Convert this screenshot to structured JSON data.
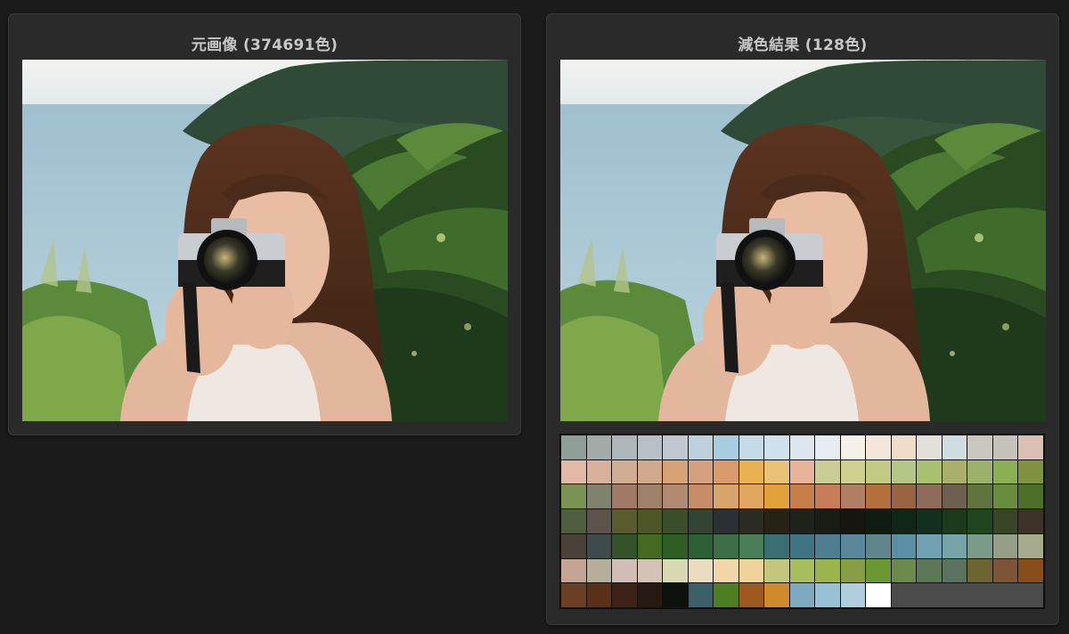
{
  "left_panel": {
    "title": "元画像 (374691色)"
  },
  "right_panel": {
    "title": "減色結果 (128色)"
  },
  "photo": {
    "sky_color": "#e9eef0",
    "sea_color": "#a9c6d2",
    "hill_color": "#2f4a36",
    "foliage_color": "#3d6b2a",
    "hair_color": "#4a2a18",
    "skin_color": "#e8bda3",
    "shirt_color": "#efe8e2",
    "camera_body": "#c9ccd0",
    "camera_lens": "#1a1a1a"
  },
  "palette": {
    "columns": 19,
    "colors": [
      "#8f9f98",
      "#a3aaa8",
      "#adb6b9",
      "#b6c1c6",
      "#bfc8cf",
      "#bdd0dc",
      "#a9cde0",
      "#c5dbe8",
      "#cfe1ec",
      "#dbe6ef",
      "#e6ecf1",
      "#f5f1e6",
      "#f3e7dc",
      "#efdccb",
      "#e3e0dc",
      "#cfdde3",
      "#cac7c0",
      "#c6c2bb",
      "#dbbfb5",
      "#e2b9a6",
      "#d9b09b",
      "#cfac92",
      "#d1a98e",
      "#d6a276",
      "#d5a07f",
      "#d99a6c",
      "#e9b14f",
      "#eac178",
      "#e7b39a",
      "#cbcd96",
      "#cdd08e",
      "#c3ca84",
      "#b4c686",
      "#a9bf72",
      "#aab06b",
      "#9cb26a",
      "#8caf53",
      "#7e923f",
      "#7a9252",
      "#80816e",
      "#9e7a66",
      "#9f8068",
      "#b08a74",
      "#c68e68",
      "#d7a46b",
      "#e0a660",
      "#e1a23c",
      "#c97e4a",
      "#c77e58",
      "#b07e64",
      "#b3703b",
      "#9a6442",
      "#8d6a5a",
      "#6d6052",
      "#60743f",
      "#6a8c3e",
      "#4c702a",
      "#4f5e3e",
      "#5c544b",
      "#5a5b2f",
      "#4e5527",
      "#3a4e2c",
      "#344433",
      "#2b3034",
      "#2c2b22",
      "#262214",
      "#1f221a",
      "#1a1d14",
      "#17150f",
      "#0f1c12",
      "#102616",
      "#13301e",
      "#1e3a1c",
      "#21461f",
      "#3a4426",
      "#3c3428",
      "#4a4238",
      "#3f4a4a",
      "#36522a",
      "#456b22",
      "#305c26",
      "#2e5e36",
      "#3c6e48",
      "#487d58",
      "#3b6e72",
      "#3e7484",
      "#507d8f",
      "#5b879a",
      "#60868c",
      "#5b8fa3",
      "#72a1b4",
      "#76a3a8",
      "#7c9a88",
      "#979e87",
      "#a6ab8e",
      "#c4a595",
      "#b5ae9a",
      "#cfbdb6",
      "#d3c3b7",
      "#d8d8b5",
      "#e9dcc0",
      "#f1d6aa",
      "#eed39b",
      "#c2c77c",
      "#a6bf5c",
      "#9bb54c",
      "#889e45",
      "#6c9833",
      "#6b8a4c",
      "#5d7757",
      "#59735e",
      "#6c6531",
      "#7d5435",
      "#874e1c",
      "#6b3f26",
      "#5a3019",
      "#3d2218",
      "#261a12",
      "#0d130c",
      "#3c5e66",
      "#4d7e22",
      "#9e5a1e",
      "#cf8a2c",
      "#7eaac0",
      "#98c1d6",
      "#b1cede",
      "#ffffff"
    ]
  }
}
